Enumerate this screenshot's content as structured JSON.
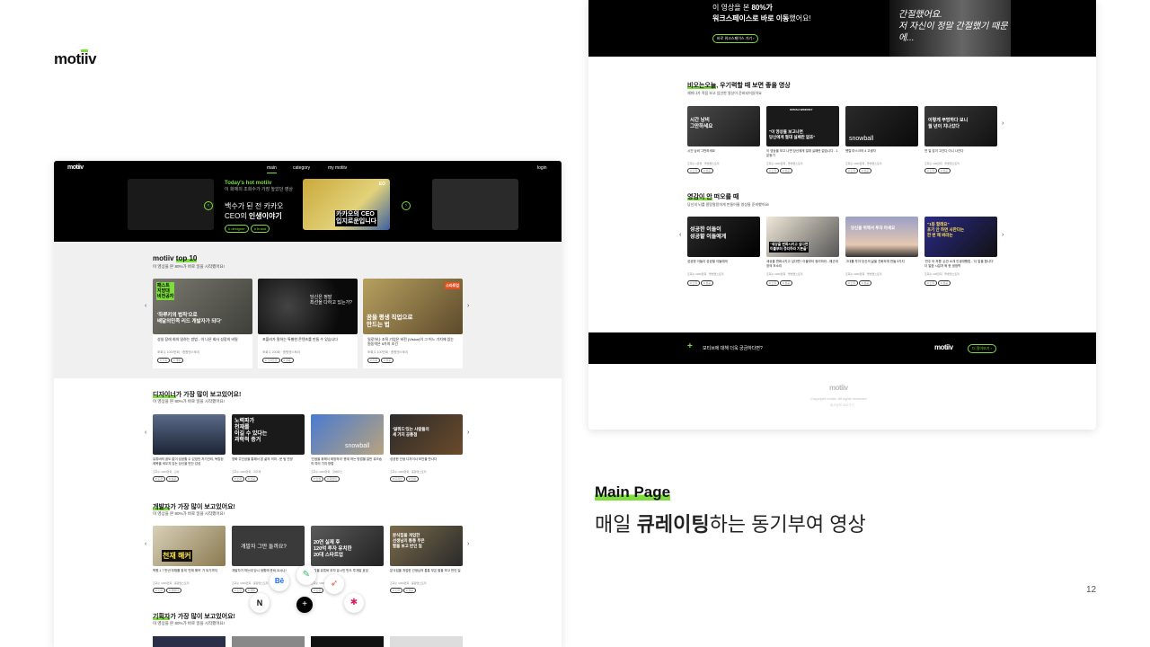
{
  "brand": {
    "name_a": "mot",
    "name_b": "ii",
    "name_c": "v"
  },
  "left": {
    "nav": {
      "main": "main",
      "category": "category",
      "mypage": "my motiiv",
      "login": "login"
    },
    "hero": {
      "label": "Today's hot motiiv",
      "sub": "이 화제의 조회수가 가장 높았던 영상",
      "line1": "백수가 된 전 카카오",
      "line2_a": "CEO의 ",
      "line2_b": "인생이야기",
      "tags": [
        "# designer",
        "# brand"
      ],
      "thumb_text": "카카오의 CEO\n입지로운입니다",
      "eo": "EO"
    },
    "top10": {
      "title_a": "motiiv",
      "title_b": "top 10",
      "sub": "이 영상을 본 80%가 바로 일을 시작했어요!",
      "cards": [
        {
          "thumb": "'하루키의 법칙'으로\n배달의민족 리드 개발자가 되다'",
          "badge": "패스트\n지방대\n비전공자",
          "caption": "성실 장래 회의 일하는 방법 - 이 나은 회사 성장의 비밀",
          "meta": "조회수 1000만회 · 종원엔스토리",
          "tags": [
            "# 기획",
            "# 개발"
          ]
        },
        {
          "thumb": "당신은 정말\n최선을 다하고 있는가?",
          "caption": "포볼러가 말하는 특별한 콘텐츠를 만들 수 있습니다",
          "meta": "조회수 200회 · 종원엔스토리",
          "tags": [
            "# 스타트업",
            "# 성공"
          ]
        },
        {
          "thumb": "꿈을 평생 직업으로\n만드는 법",
          "badge": "스타트업",
          "caption": "일로하나 조직 기업은 비전 (Vision)이 그 어느 가치에 있는 원동력은 5가지 조건",
          "meta": "조회수 100만회 · 종원엔스토리",
          "tags": [
            "# 기획",
            "# 성공"
          ]
        }
      ]
    },
    "designer": {
      "title_a": "디자이너",
      "title_b": "가 가장 많이 보고있어요!",
      "sub": "이 영상을 본 80%가 바로 일을 시작했어요!",
      "cards": [
        {
          "thumb": "",
          "caption": "유튜버의 꿈도 없이 성공할 수 있었던 자기관리, 독립된 제목을 세우지 않는 당신을 맛단 감성",
          "meta": "조회수 1000만회 · 감성",
          "tags": [
            "# 도전",
            "# 성공"
          ]
        },
        {
          "thumb": "노력파가\n천재를\n이길 수 있다는\n과학적 증거",
          "caption": "영화 주인공을 통해서 본 삶의 의미 - 문 팀 연방",
          "meta": "조회수 1000만회 · 과다제",
          "tags": [
            "# 노력",
            "# 신념"
          ]
        },
        {
          "thumb": "snowball",
          "caption": "'인생을 위해서 희망하라' 층계 하는 방법을 일반 워크숍의 여러 가지 방법",
          "meta": "조회수 1000만회 · 핫에이스",
          "tags": [
            "# 인생",
            "# 희망학"
          ]
        },
        {
          "thumb": "'잃뭐드'있는 사람들의\n세 가지 공통점",
          "caption": "성공한 인생 디자이너 보안을 만나다",
          "meta": "조회수 1000만회 · 종원엔스토리",
          "tags": [
            "# 디자인",
            "# 인생"
          ]
        }
      ]
    },
    "developer": {
      "title_a": "개발자",
      "title_b": "가 가장 많이 보고있어요!",
      "sub": "이 영상을 본 80%가 바로 일을 시작했어요!",
      "cards": [
        {
          "thumb": "천재 해커",
          "caption": "학원 1.7 만년 부채를 찾게 '천재 해커' 가 되기까지",
          "meta": "조회수 1000만회 · 종원엔스토리",
          "tags": [
            "# 노력",
            "# 개발자"
          ]
        },
        {
          "thumb": "개발자 그만 둘까요?",
          "caption": "개발자가 하는데 당시 생활에 준비 오시나!",
          "meta": "조회수 1000만회 · 종원엔스토리",
          "tags": [
            "# 도전",
            "# 개발"
          ]
        },
        {
          "thumb": "20연 실제 후\n120억 투자 유치한\n20대 스타트업",
          "caption": "보일을 유튜버 부자 유시민 반도 투개발 호딩",
          "meta": "조회수 1000만회",
          "tags": [
            "# 인생"
          ]
        },
        {
          "thumb": "분식집을 개업한\n선생님의 통통 부은\n팔을 보고 반인 일",
          "caption": "분식집을 개업한 선생님의 통통 부은 팔을 보고 반인 일",
          "meta": "조회수 1000만회 · 종원엔스토리",
          "tags": [
            "# 노력",
            "# 성공"
          ]
        }
      ]
    },
    "planner": {
      "title_a": "기획자",
      "title_b": "가 가장 많이 보고있어요!",
      "sub": "이 영상을 본 80%가 바로 일을 시작했어요!"
    }
  },
  "right": {
    "hero": {
      "line1_a": "이 영상을 본 ",
      "line1_b": "80%가",
      "line2_a": "워크스페이스로 바로 ",
      "line2_b": "이동",
      "line2_c": "했어요!",
      "button": "바로 워크스페이스 가기  ›",
      "overlay": "간절했어요.\n저 자신이 정말 간절했기 때문에..."
    },
    "section1": {
      "title_a": "비오는오늘",
      "title_b": ", 우기력할 때 보면 좋을 영상",
      "sub": "재미나가 직접 보고 엄선한 영상이 준비되어있어요",
      "cards": [
        {
          "thumb": "시간 낭비\n그만하세요",
          "caption": "시간 낭비 그만하세요",
          "meta": "조회수 1만회 · 올뱃젠스토리",
          "tags": [
            "# 노력",
            "# 성공"
          ]
        },
        {
          "thumb": "\"이 영상을 보고나면\n당신에게 절대 실패란 없죠\"",
          "badge": "OPRAH WINFREY",
          "caption": "이 영상을 보고 나면 당신에게 절대 실패란 없습니다 - 1분동기",
          "meta": "조회수 1000만회 · 올뱃젠스토리",
          "tags": [
            "# 노력",
            "# 성공"
          ]
        },
        {
          "thumb": "snowball",
          "caption": "멘탈 마스크의 4 고생자",
          "meta": "조회수 1000만회 · 올뱃젠스토리",
          "tags": [
            "# 노력",
            "# 성공"
          ]
        },
        {
          "thumb": "이렇게 부멍하다 보니\n월 년이 지나갔다",
          "caption": "연 일 않이 고간다 이니 나간다",
          "meta": "조회수 100만회 · 올뱃젠스토리",
          "tags": [
            "# 노력",
            "# 성공"
          ]
        }
      ]
    },
    "section2": {
      "title_a": "영감이 안",
      "title_b": " 떠오를 때",
      "sub": "당신의 뇌를 말랑말랑하게 만들어줄 영상들 준비했어요!",
      "cards": [
        {
          "thumb": "성공한 이들이\n성공할 이들에게",
          "caption": "성공한 이들이 성공할 이들에게",
          "meta": "조회수 1000만회 · 올뱃젠스토리",
          "tags": [
            "# 노력",
            "# 성공"
          ]
        },
        {
          "thumb": "\"세상을 변화시키고 싶다면\n이불부터 정리하라 기본을\"",
          "caption": "세상을 변화시키고 싶다면? 이불부터 정리하라 - 해군대장의 조소리",
          "meta": "조회수 1000만회 · 올뱃젠스토리",
          "tags": [
            "# 노력",
            "# 성공"
          ]
        },
        {
          "thumb": "당신을 위해서 투자 마세요",
          "caption": "그대를 투자 당신의 삶을 진화하게 만들 5가지",
          "meta": "조회수 1000만회 · 올뱃젠스토리",
          "tags": [
            "# 노력",
            "# 성공"
          ]
        },
        {
          "thumb": "\"1등 할래요\"\n포기 안 하면 사한다는\n한 번 해 봐라는",
          "caption": "'연주 어 저쯤' 손안 소개 인생대빵법 - '더 말을 합니다' 더 말씀 시분처 퇴 한 생정학",
          "meta": "조회수 100만회 · 올뱃젠스토리",
          "tags": [
            "# 노력",
            "# 성공"
          ]
        }
      ]
    },
    "footer_bar": {
      "text": "모티브에 대해 더욱 궁금하다면?",
      "button": "더 알아보기 ›"
    },
    "footer": {
      "copyright": "Copyright motiiv. All rights reserved",
      "info": "회사정보 바로가기"
    }
  },
  "slide": {
    "label": "Main Page",
    "desc_a": "매일 ",
    "desc_b": "큐레이팅",
    "desc_c": "하는 동기부여 영상",
    "page": "12"
  },
  "colors": {
    "accent": "#7dde3b",
    "dark": "#000000"
  }
}
